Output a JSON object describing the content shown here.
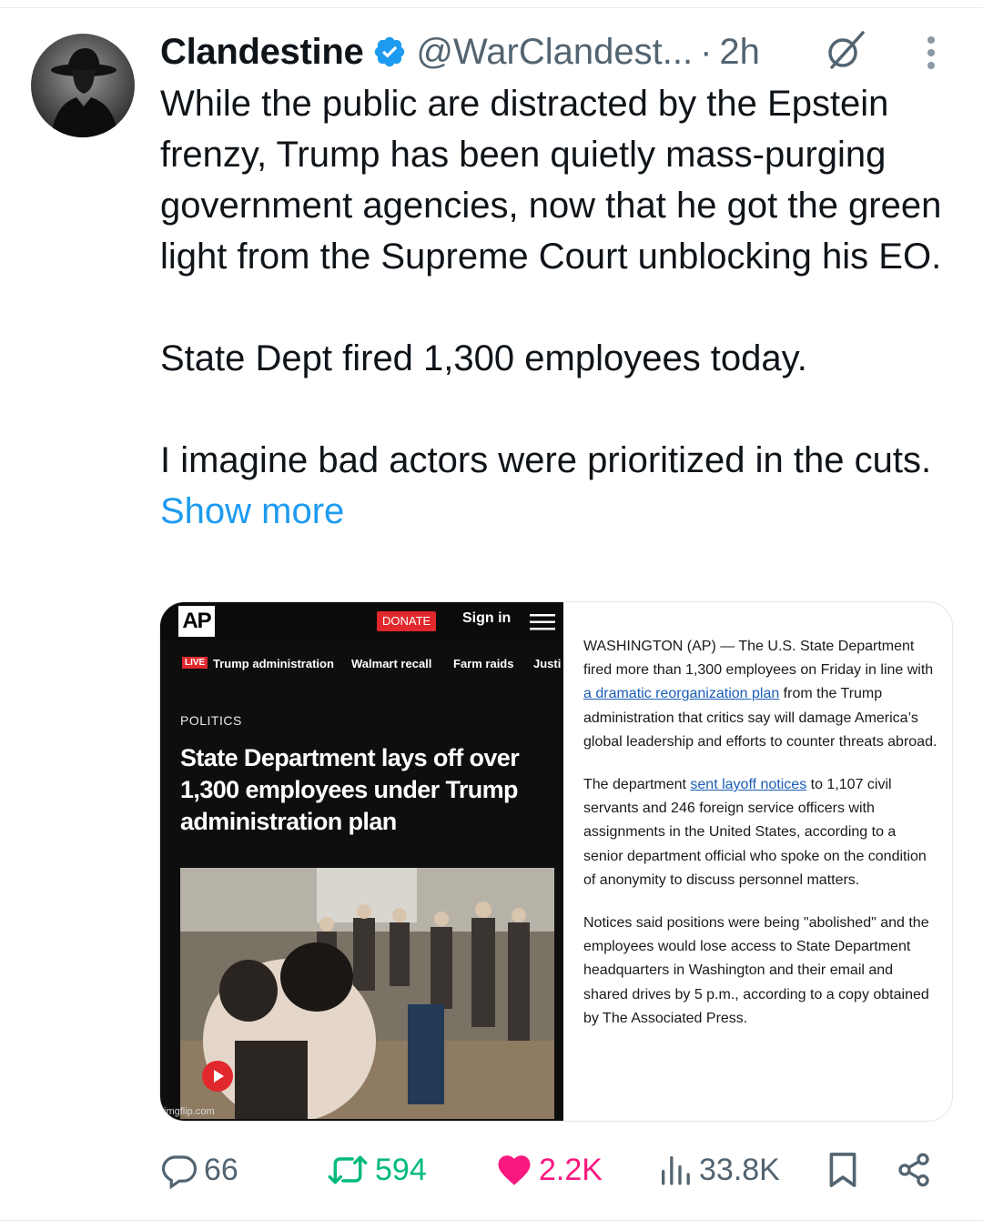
{
  "author": {
    "name": "Clandestine",
    "handle": "@WarClandest...",
    "separator": "·",
    "time": "2h"
  },
  "tweet": {
    "paragraphs": [
      "While the public are distracted by the Epstein frenzy, Trump has been quietly mass-purging government agencies, now that he got the green light from the Supreme Court unblocking his EO.",
      "State Dept fired 1,300 employees today.",
      "I imagine bad actors were prioritized in the cuts."
    ],
    "show_more": "Show more"
  },
  "card": {
    "ap": {
      "logo": "AP",
      "donate": "DONATE",
      "sign_in": "Sign in",
      "live": "LIVE",
      "nav": [
        "Trump administration",
        "Walmart recall",
        "Farm raids",
        "Justi"
      ],
      "section": "POLITICS",
      "headline": "State Department lays off over 1,300 employees under Trump administration plan",
      "watermark": "imgflip.com"
    },
    "article": {
      "p1_a": "WASHINGTON (AP) — The U.S. State Department fired more than 1,300 employees on Friday in line with ",
      "p1_link": "a dramatic reorganization plan",
      "p1_b": " from the Trump administration that critics say will damage America’s global leadership and efforts to counter threats abroad.",
      "p2_a": "The department ",
      "p2_link": "sent layoff notices",
      "p2_b": " to 1,107 civil servants and 246 foreign service officers with assignments in the United States, according to a senior department official who spoke on the condition of anonymity to discuss personnel matters.",
      "p3": "Notices said positions were being \"abolished\" and the employees would lose access to State Department headquarters in Washington and their email and shared drives by 5 p.m., according to a copy obtained by The Associated Press."
    }
  },
  "stats": {
    "replies": "66",
    "reposts": "594",
    "likes": "2.2K",
    "views": "33.8K"
  },
  "colors": {
    "link_blue": "#1d9bf0",
    "repost_green": "#00ba7c",
    "like_pink": "#f91880",
    "muted_gray": "#536471",
    "ap_red": "#e0282d"
  },
  "icons": [
    "verified-badge-icon",
    "grok-icon",
    "more-options-icon",
    "reply-icon",
    "repost-icon",
    "heart-icon",
    "views-icon",
    "bookmark-icon",
    "share-icon",
    "menu-icon",
    "play-icon"
  ]
}
